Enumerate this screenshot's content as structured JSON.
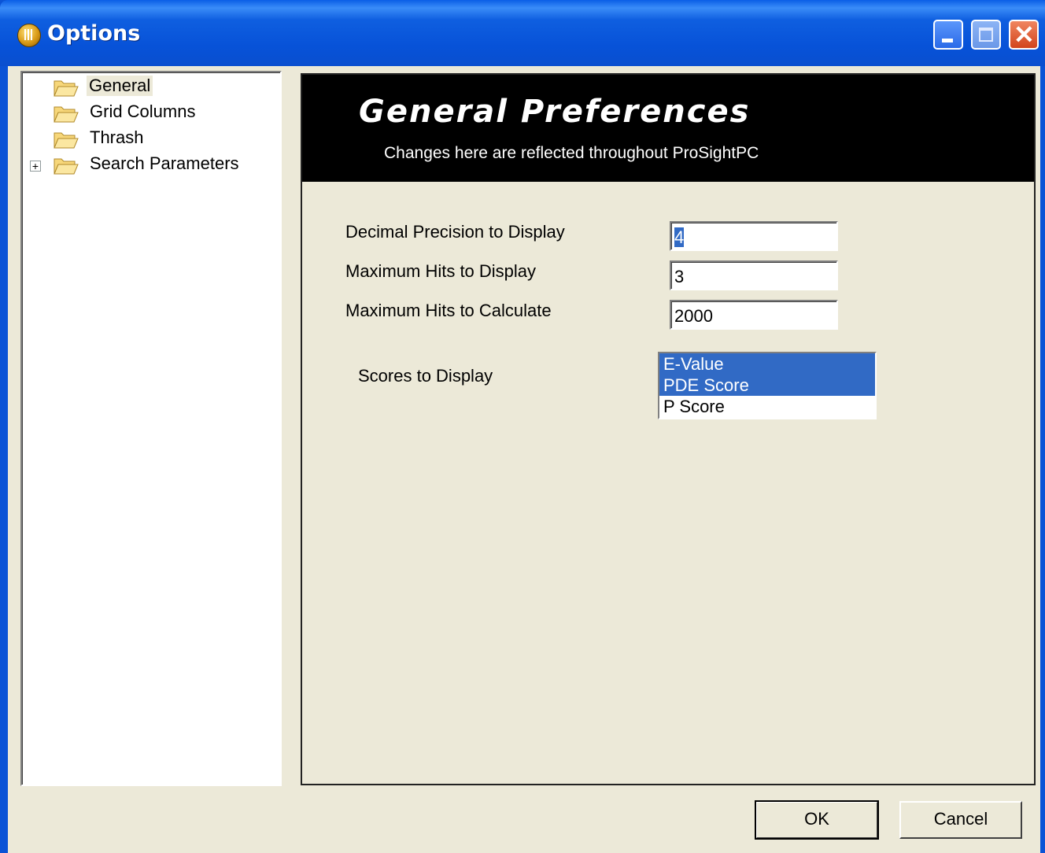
{
  "window": {
    "title": "Options"
  },
  "tree": {
    "items": [
      {
        "label": "General",
        "selected": true,
        "expandable": false
      },
      {
        "label": "Grid Columns",
        "selected": false,
        "expandable": false
      },
      {
        "label": "Thrash",
        "selected": false,
        "expandable": false
      },
      {
        "label": "Search Parameters",
        "selected": false,
        "expandable": true
      }
    ],
    "expander_glyph": "+"
  },
  "panel": {
    "title": "General Preferences",
    "subtitle": "Changes here are reflected throughout ProSightPC"
  },
  "fields": {
    "decimal_precision": {
      "label": "Decimal Precision to Display",
      "value": "4"
    },
    "max_hits_display": {
      "label": "Maximum Hits to Display",
      "value": "3"
    },
    "max_hits_calculate": {
      "label": "Maximum Hits to Calculate",
      "value": "2000"
    }
  },
  "scores": {
    "label": "Scores to Display",
    "options": [
      {
        "label": "E-Value",
        "selected": true
      },
      {
        "label": "PDE Score",
        "selected": true
      },
      {
        "label": "P Score",
        "selected": false
      }
    ]
  },
  "buttons": {
    "ok": "OK",
    "cancel": "Cancel"
  },
  "colors": {
    "title_bar": "#0a53d6",
    "dialog_bg": "#ece9d8",
    "selection": "#316ac5",
    "header_bg": "#000000"
  }
}
